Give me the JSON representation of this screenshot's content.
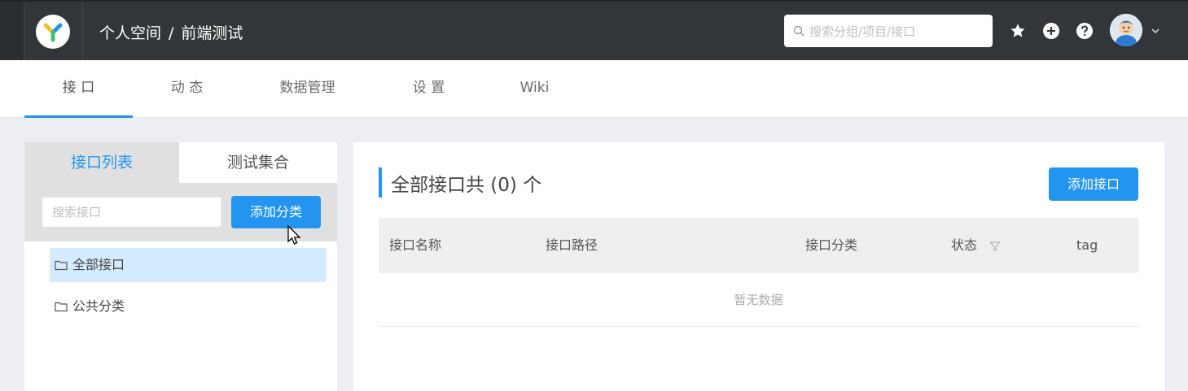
{
  "topbar": {
    "breadcrumb_space": "个人空间",
    "breadcrumb_sep": "/",
    "breadcrumb_project": "前端测试",
    "search_placeholder": "搜索分组/项目/接口"
  },
  "subnav": {
    "tabs": [
      {
        "label": "接 口"
      },
      {
        "label": "动 态"
      },
      {
        "label": "数据管理"
      },
      {
        "label": "设 置"
      },
      {
        "label": "Wiki"
      }
    ]
  },
  "left": {
    "tabs": [
      {
        "label": "接口列表"
      },
      {
        "label": "测试集合"
      }
    ],
    "search_placeholder": "搜索接口",
    "add_category": "添加分类",
    "tree": [
      {
        "label": "全部接口"
      },
      {
        "label": "公共分类"
      }
    ]
  },
  "main": {
    "title": "全部接口共 (0) 个",
    "add_api": "添加接口",
    "columns": [
      {
        "label": "接口名称"
      },
      {
        "label": "接口路径"
      },
      {
        "label": "接口分类"
      },
      {
        "label": "状态"
      },
      {
        "label": "tag"
      }
    ],
    "empty_text": "暂无数据"
  },
  "colors": {
    "topbar": "#32363a",
    "accent": "#2395f1"
  },
  "icons": [
    "logo-icon",
    "search-icon",
    "star-icon",
    "plus-circle-icon",
    "question-circle-icon",
    "chevron-down-icon",
    "folder-icon",
    "filter-icon",
    "cursor-icon"
  ]
}
